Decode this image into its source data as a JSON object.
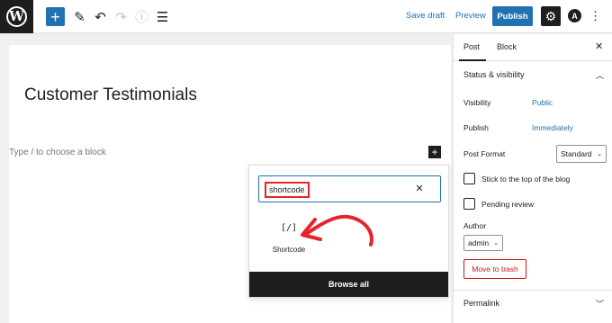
{
  "toolbar": {
    "logo_letter": "W",
    "add_icon": "+",
    "tools_icon": "✎",
    "undo_icon": "↶",
    "redo_icon": "↷",
    "info_icon": "ⓘ",
    "list_view_icon": "☰",
    "save_draft_label": "Save draft",
    "preview_label": "Preview",
    "publish_label": "Publish",
    "settings_icon": "⚙",
    "astra_letter": "A",
    "more_icon": "⋮"
  },
  "editor": {
    "post_title": "Customer Testimonials",
    "placeholder": "Type / to choose a block",
    "inline_add_icon": "+"
  },
  "inserter": {
    "search_value": "shortcode",
    "clear_icon": "✕",
    "results": [
      {
        "icon_text": "[/]",
        "label": "Shortcode"
      }
    ],
    "browse_all_label": "Browse all"
  },
  "sidebar": {
    "tabs": [
      {
        "label": "Post",
        "active": true
      },
      {
        "label": "Block",
        "active": false
      }
    ],
    "close_icon": "✕",
    "status_panel": {
      "title": "Status & visibility",
      "visibility_label": "Visibility",
      "visibility_value": "Public",
      "publish_label": "Publish",
      "publish_value": "Immediately",
      "post_format_label": "Post Format",
      "post_format_value": "Standard",
      "sticky_label": "Stick to the top of the blog",
      "pending_label": "Pending review",
      "author_label": "Author",
      "author_value": "admin",
      "trash_label": "Move to trash"
    },
    "permalink_panel": {
      "title": "Permalink"
    }
  },
  "colors": {
    "accent": "#2271b1",
    "dark": "#1e1e1e",
    "highlight_red": "#e8232a",
    "trash_red": "#cc1818"
  }
}
